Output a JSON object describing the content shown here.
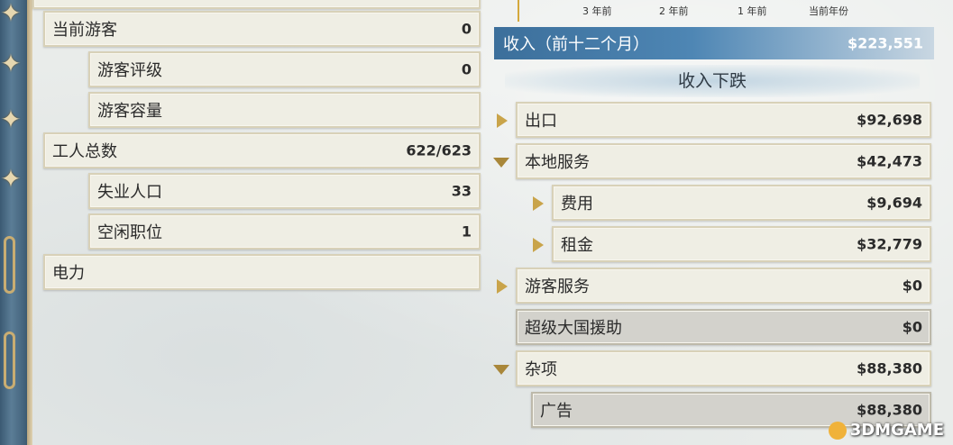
{
  "left_panel": {
    "rows": [
      {
        "label": "当前游客",
        "value": "0"
      },
      {
        "label": "游客评级",
        "value": "0"
      },
      {
        "label": "游客容量",
        "value": ""
      },
      {
        "label": "工人总数",
        "value": "622/623"
      },
      {
        "label": "失业人口",
        "value": "33"
      },
      {
        "label": "空闲职位",
        "value": "1"
      },
      {
        "label": "电力",
        "value": ""
      }
    ]
  },
  "chart_axis": {
    "ticks": [
      "3 年前",
      "2 年前",
      "1 年前",
      "当前年份"
    ]
  },
  "income": {
    "label": "收入（前十二个月）",
    "value": "$223,551",
    "breakdown_title": "收入下跌",
    "rows": [
      {
        "label": "出口",
        "value": "$92,698"
      },
      {
        "label": "本地服务",
        "value": "$42,473"
      },
      {
        "label": "费用",
        "value": "$9,694"
      },
      {
        "label": "租金",
        "value": "$32,779"
      },
      {
        "label": "游客服务",
        "value": "$0"
      },
      {
        "label": "超级大国援助",
        "value": "$0"
      },
      {
        "label": "杂项",
        "value": "$88,380"
      },
      {
        "label": "广告",
        "value": "$88,380"
      }
    ]
  },
  "watermark": "3DMGAME",
  "colors": {
    "banner": "#3c6f9b",
    "arrow": "#c9a44a",
    "cell": "#efeee4"
  }
}
